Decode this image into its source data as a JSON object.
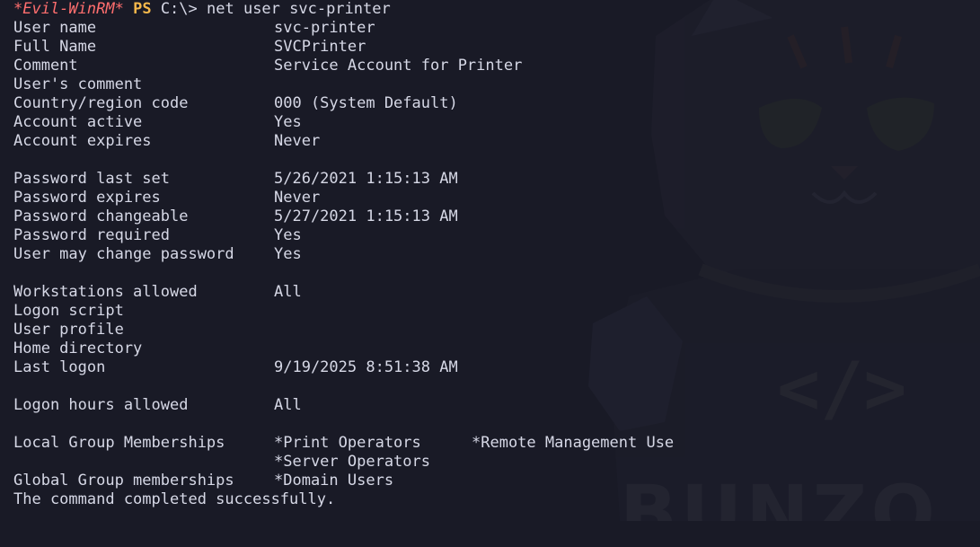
{
  "terminal": {
    "prompt": {
      "shell": "*Evil-WinRM*",
      "ps": "PS",
      "path": "C:\\>",
      "command": "net user svc-printer"
    },
    "fields": [
      {
        "key": "User name",
        "value": "svc-printer"
      },
      {
        "key": "Full Name",
        "value": "SVCPrinter"
      },
      {
        "key": "Comment",
        "value": "Service Account for Printer"
      },
      {
        "key": "User's comment",
        "value": ""
      },
      {
        "key": "Country/region code",
        "value": "000 (System Default)"
      },
      {
        "key": "Account active",
        "value": "Yes"
      },
      {
        "key": "Account expires",
        "value": "Never"
      },
      {
        "key": "Password last set",
        "value": "5/26/2021 1:15:13 AM"
      },
      {
        "key": "Password expires",
        "value": "Never"
      },
      {
        "key": "Password changeable",
        "value": "5/27/2021 1:15:13 AM"
      },
      {
        "key": "Password required",
        "value": "Yes"
      },
      {
        "key": "User may change password",
        "value": "Yes"
      },
      {
        "key": "Workstations allowed",
        "value": "All"
      },
      {
        "key": "Logon script",
        "value": ""
      },
      {
        "key": "User profile",
        "value": ""
      },
      {
        "key": "Home directory",
        "value": ""
      },
      {
        "key": "Last logon",
        "value": "9/19/2025 8:51:38 AM"
      },
      {
        "key": "Logon hours allowed",
        "value": "All"
      },
      {
        "key": "Local Group Memberships",
        "value": "*Print Operators",
        "value2": "*Remote Management Use"
      },
      {
        "key": "",
        "value": "*Server Operators"
      },
      {
        "key": "Global Group memberships",
        "value": "*Domain Users"
      }
    ],
    "result": "The command completed successfully."
  },
  "background": {
    "watermark_text": "BUNZO",
    "code_glyph": "</>",
    "accent_color": "#f5b84b",
    "shell_color": "#ff6e6e"
  }
}
